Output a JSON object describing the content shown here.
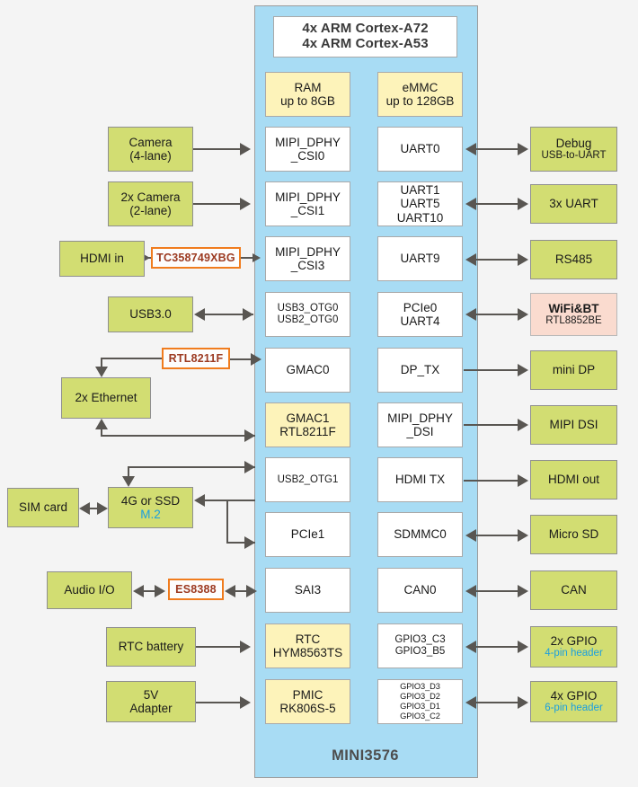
{
  "diagram": {
    "title": "MINI3576",
    "soc_label": "MINI3576",
    "colors": {
      "soc_fill": "#a8dcf4",
      "peripheral_green": "#d2dd72",
      "memory_yellow": "#fdf3ba",
      "wifi_pink": "#fadbcf",
      "chip_outline": "#f07c1e",
      "chip_text": "#9c3a21",
      "sub_label_blue": "#1a9fe0",
      "wire": "#595652",
      "background": "#f4f4f4"
    }
  },
  "cpu": {
    "line1": "4x ARM Cortex-A72",
    "line2": "4x ARM Cortex-A53"
  },
  "memory": [
    {
      "name": "RAM",
      "detail": "up to 8GB"
    },
    {
      "name": "eMMC",
      "detail": "up to 128GB"
    }
  ],
  "soc_left_column": [
    {
      "line1": "MIPI_DPHY",
      "line2": "_CSI0",
      "style": "white"
    },
    {
      "line1": "MIPI_DPHY",
      "line2": "_CSI1",
      "style": "white"
    },
    {
      "line1": "MIPI_DPHY",
      "line2": "_CSI3",
      "style": "white"
    },
    {
      "line1": "USB3_OTG0",
      "line2": "USB2_OTG0",
      "style": "white"
    },
    {
      "line1": "GMAC0",
      "line2": "",
      "style": "white"
    },
    {
      "line1": "GMAC1",
      "line2": "RTL8211F",
      "style": "yellow"
    },
    {
      "line1": "USB2_OTG1",
      "line2": "",
      "style": "white"
    },
    {
      "line1": "PCIe1",
      "line2": "",
      "style": "white"
    },
    {
      "line1": "SAI3",
      "line2": "",
      "style": "white"
    },
    {
      "line1": "RTC",
      "line2": "HYM8563TS",
      "style": "yellow"
    },
    {
      "line1": "PMIC",
      "line2": "RK806S-5",
      "style": "yellow"
    }
  ],
  "soc_right_column": [
    {
      "lines": [
        "UART0"
      ],
      "style": "white"
    },
    {
      "lines": [
        "UART1",
        "UART5",
        "UART10"
      ],
      "style": "white"
    },
    {
      "lines": [
        "UART9"
      ],
      "style": "white"
    },
    {
      "lines": [
        "PCIe0",
        "UART4"
      ],
      "style": "white"
    },
    {
      "lines": [
        "DP_TX"
      ],
      "style": "white"
    },
    {
      "lines": [
        "MIPI_DPHY",
        "_DSI"
      ],
      "style": "white"
    },
    {
      "lines": [
        "HDMI TX"
      ],
      "style": "white"
    },
    {
      "lines": [
        "SDMMC0"
      ],
      "style": "white"
    },
    {
      "lines": [
        "CAN0"
      ],
      "style": "white"
    },
    {
      "lines": [
        "GPIO3_C3",
        "GPIO3_B5"
      ],
      "style": "white"
    },
    {
      "lines": [
        "GPIO3_D3",
        "GPIO3_D2",
        "GPIO3_D1",
        "GPIO3_C2"
      ],
      "style": "white"
    }
  ],
  "left_peripherals": [
    {
      "line1": "Camera",
      "line2": "(4-lane)",
      "style": "green"
    },
    {
      "line1": "2x Camera",
      "line2": "(2-lane)",
      "style": "green"
    },
    {
      "line1": "HDMI in",
      "line2": "",
      "style": "green"
    },
    {
      "line1": "USB3.0",
      "line2": "",
      "style": "green"
    },
    {
      "line1": "2x Ethernet",
      "line2": "",
      "style": "green"
    },
    {
      "line1": "SIM card",
      "line2": "",
      "style": "green"
    },
    {
      "line1": "4G or SSD",
      "line2": "M.2",
      "style": "green",
      "sub_blue": true
    },
    {
      "line1": "Audio I/O",
      "line2": "",
      "style": "green"
    },
    {
      "line1": "RTC battery",
      "line2": "",
      "style": "green"
    },
    {
      "line1": "5V",
      "line2": "Adapter",
      "style": "green"
    }
  ],
  "chips": [
    {
      "name": "TC358749XBG"
    },
    {
      "name": "RTL8211F"
    },
    {
      "name": "ES8388"
    }
  ],
  "right_peripherals": [
    {
      "line1": "Debug",
      "line2": "USB-to-UART",
      "style": "green",
      "sub_small": true
    },
    {
      "line1": "3x UART",
      "line2": "",
      "style": "green"
    },
    {
      "line1": "RS485",
      "line2": "",
      "style": "green"
    },
    {
      "line1": "WiFi&BT",
      "line2": "RTL8852BE",
      "style": "pink",
      "bold_title": true
    },
    {
      "line1": "mini DP",
      "line2": "",
      "style": "green"
    },
    {
      "line1": "MIPI DSI",
      "line2": "",
      "style": "green"
    },
    {
      "line1": "HDMI out",
      "line2": "",
      "style": "green"
    },
    {
      "line1": "Micro SD",
      "line2": "",
      "style": "green"
    },
    {
      "line1": "CAN",
      "line2": "",
      "style": "green"
    },
    {
      "line1": "2x GPIO",
      "line2": "4-pin header",
      "style": "green",
      "sub_blue": true
    },
    {
      "line1": "4x GPIO",
      "line2": "6-pin header",
      "style": "green",
      "sub_blue": true
    }
  ]
}
